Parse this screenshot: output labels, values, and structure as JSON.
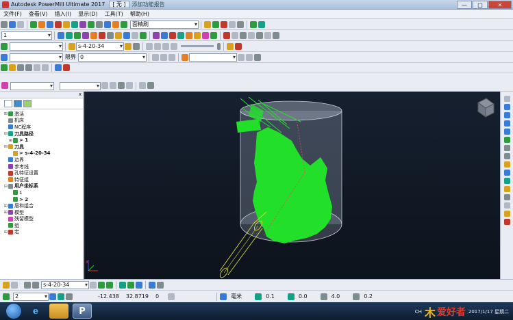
{
  "window": {
    "title": "Autodesk PowerMill Ultimate 2017",
    "doc_tab": "[ 无 ]",
    "hint": "添加功能报告",
    "min": "—",
    "max": "□",
    "close": "✕"
  },
  "menu": [
    "文件(F)",
    "查看(V)",
    "插入(I)",
    "显示(D)",
    "工具(T)",
    "帮助(H)"
  ],
  "toolbars": {
    "row1_combo": "面精刷",
    "row2_combo": "1",
    "row3_toolpath": "s-4-20-34",
    "row4_label": "限界",
    "row4_value": "0"
  },
  "explorer": {
    "close": "x",
    "nodes": [
      {
        "label": "激活",
        "level": 0,
        "expand": "⊞",
        "color": "#2e9b3e",
        "bold": false
      },
      {
        "label": "机床",
        "level": 0,
        "expand": "",
        "color": "#7f8c8d",
        "bold": false
      },
      {
        "label": "NC程序",
        "level": 0,
        "expand": "",
        "color": "#3a7bd5",
        "bold": false
      },
      {
        "label": "刀具路径",
        "level": 0,
        "expand": "⊟",
        "color": "#16a085",
        "bold": true
      },
      {
        "label": "> 1",
        "level": 1,
        "expand": "⊞",
        "color": "#2e9b3e",
        "bold": true
      },
      {
        "label": "刀具",
        "level": 0,
        "expand": "⊟",
        "color": "#d9a21c",
        "bold": true
      },
      {
        "label": "> s-4-20-34",
        "level": 1,
        "expand": "",
        "color": "#d9a21c",
        "bold": true
      },
      {
        "label": "边界",
        "level": 0,
        "expand": "",
        "color": "#3a7bd5",
        "bold": false
      },
      {
        "label": "参考线",
        "level": 0,
        "expand": "",
        "color": "#8e44ad",
        "bold": false
      },
      {
        "label": "孔特征设置",
        "level": 0,
        "expand": "",
        "color": "#c0392b",
        "bold": false
      },
      {
        "label": "特征组",
        "level": 0,
        "expand": "",
        "color": "#e67e22",
        "bold": false
      },
      {
        "label": "用户坐标系",
        "level": 0,
        "expand": "⊟",
        "color": "#7f8c8d",
        "bold": true
      },
      {
        "label": "1",
        "level": 1,
        "expand": "",
        "color": "#2e9b3e",
        "bold": false
      },
      {
        "label": "> 2",
        "level": 1,
        "expand": "",
        "color": "#2e9b3e",
        "bold": true
      },
      {
        "label": "层和组合",
        "level": 0,
        "expand": "⊞",
        "color": "#3a7bd5",
        "bold": false
      },
      {
        "label": "模型",
        "level": 0,
        "expand": "⊞",
        "color": "#8e44ad",
        "bold": false
      },
      {
        "label": "残留模型",
        "level": 0,
        "expand": "",
        "color": "#d33fb0",
        "bold": false
      },
      {
        "label": "组",
        "level": 0,
        "expand": "",
        "color": "#2e9b3e",
        "bold": false
      },
      {
        "label": "宏",
        "level": 0,
        "expand": "⊞",
        "color": "#c0392b",
        "bold": false
      }
    ]
  },
  "bottom_toolbar": {
    "tool": "s-4-20-34"
  },
  "status": {
    "workplane": "2",
    "x": "-12.438",
    "y": "32.8719",
    "z": "0",
    "unit": "毫米",
    "tol1": "0.1",
    "tol2": "0.0",
    "tol3": "4.0",
    "tol4": "0.2"
  },
  "viewport": {
    "colors": {
      "stock": "#9aa5b6",
      "toolpath": "#22e02a",
      "tool": "#d8d83a",
      "axis_x": "#e03030",
      "axis_y": "#30c030",
      "axis_z": "#3050e0"
    }
  },
  "taskbar": {
    "ch": "CH",
    "watermark_1": "木",
    "watermark_2": "爱好者",
    "date": "2017/1/17 星期二"
  }
}
